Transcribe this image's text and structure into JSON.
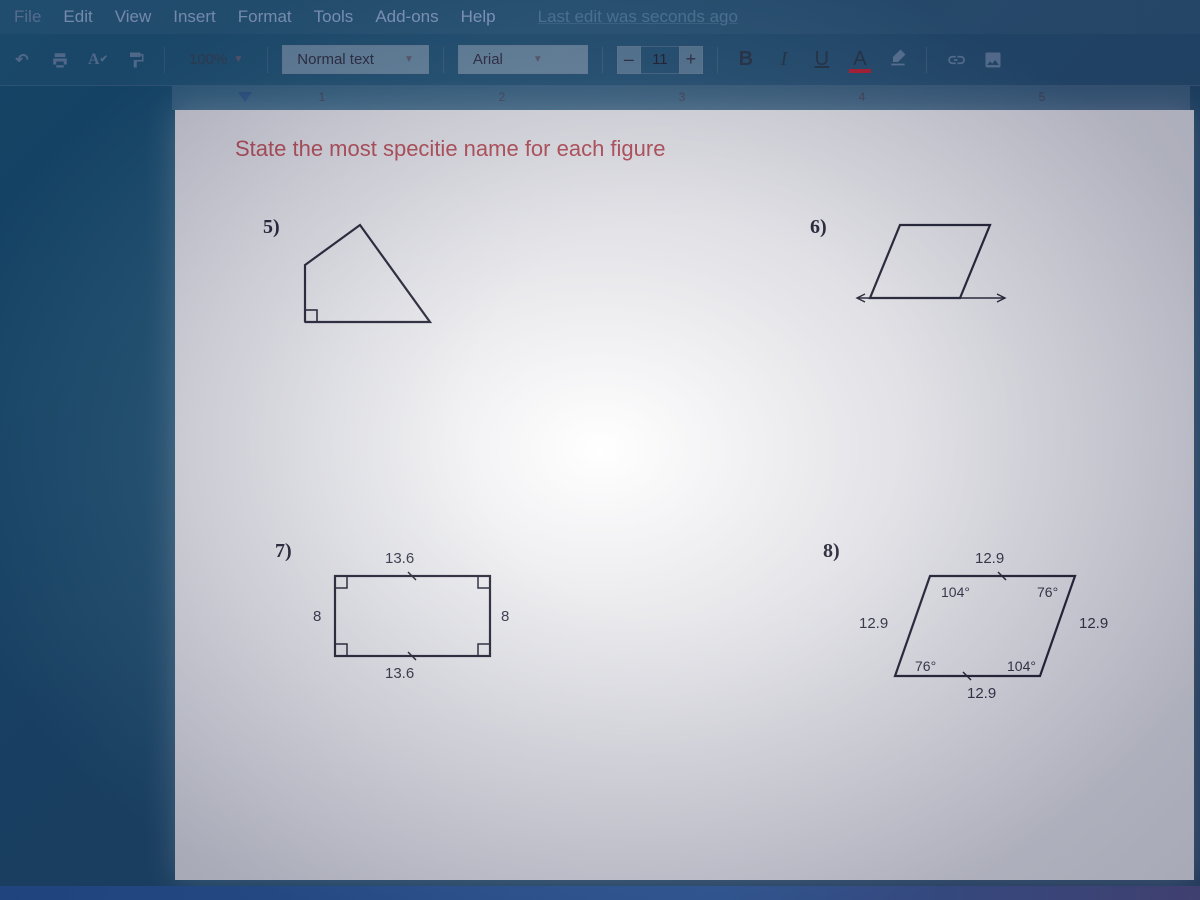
{
  "menu": {
    "items": [
      "File",
      "Edit",
      "View",
      "Insert",
      "Format",
      "Tools",
      "Add-ons",
      "Help"
    ],
    "last_edit": "Last edit was seconds ago"
  },
  "toolbar": {
    "zoom": "100%",
    "paragraph_style": "Normal text",
    "font": "Arial",
    "font_size_minus": "–",
    "font_size": "11",
    "font_size_plus": "+",
    "bold": "B",
    "italic": "I",
    "underline": "U",
    "text_color": "A"
  },
  "ruler": {
    "marks": [
      "1",
      "2",
      "3",
      "4",
      "5"
    ]
  },
  "document": {
    "heading": "State the most specitie name for each figure",
    "problems": {
      "p5": {
        "label": "5)"
      },
      "p6": {
        "label": "6)"
      },
      "p7": {
        "label": "7)",
        "top": "13.6",
        "bottom": "13.6",
        "left": "8",
        "right": "8"
      },
      "p8": {
        "label": "8)",
        "top": "12.9",
        "bottom": "12.9",
        "left": "12.9",
        "right": "12.9",
        "ang_tl": "104°",
        "ang_tr": "76°",
        "ang_bl": "76°",
        "ang_br": "104°"
      }
    }
  }
}
